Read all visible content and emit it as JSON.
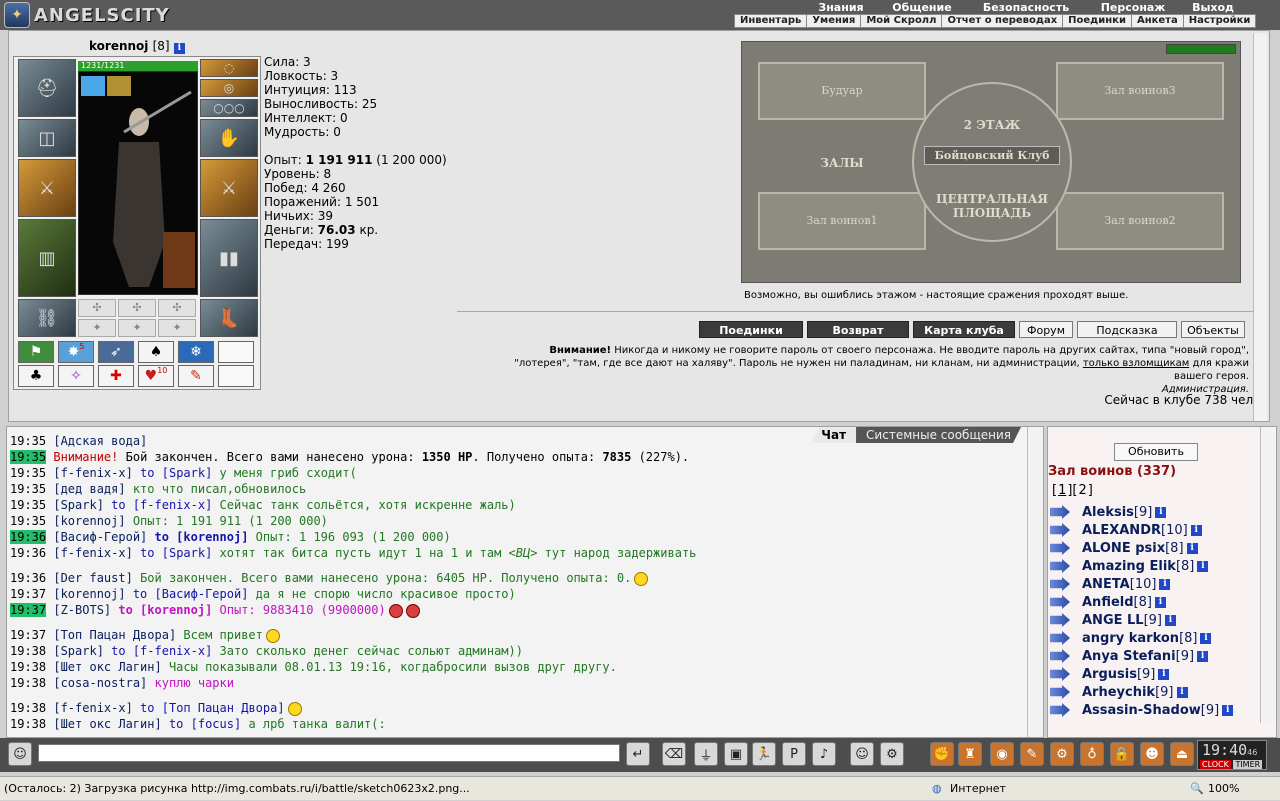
{
  "app": {
    "logo": "ANGELSCITY"
  },
  "menu": {
    "top": [
      "Знания",
      "Общение",
      "Безопасность",
      "Персонаж",
      "Выход"
    ],
    "sub": [
      "Инвентарь",
      "Умения",
      "Мой Скролл",
      "Отчет о переводах",
      "Поединки",
      "Анкета",
      "Настройки"
    ]
  },
  "player": {
    "nick": "korennoj",
    "level": "[8]",
    "hp": "1231/1231",
    "stats": [
      "Сила: 3",
      "Ловкость: 3",
      "Интуиция: 113",
      "Выносливость: 25",
      "Интеллект: 0",
      "Мудрость: 0"
    ],
    "stats2": [
      {
        "label": "Опыт:",
        "bold": "1 191 911",
        "rest": " (1 200 000)"
      },
      {
        "label": "Уровень:",
        "bold": "",
        "rest": " 8"
      },
      {
        "label": "Побед:",
        "bold": "",
        "rest": " 4 260"
      },
      {
        "label": "Поражений:",
        "bold": "",
        "rest": " 1 501"
      },
      {
        "label": "Ничьих:",
        "bold": "",
        "rest": " 39"
      },
      {
        "label": "Деньги:",
        "bold": "76.03",
        "rest": " кр."
      },
      {
        "label": "Передач:",
        "bold": "",
        "rest": " 199"
      }
    ],
    "belt_counts": [
      "5",
      "10"
    ]
  },
  "map": {
    "rooms": [
      "Будуар",
      "Зал воинов3",
      "Зал воинов1",
      "Зал воинов2"
    ],
    "floor": "2 ЭТАЖ",
    "club": "Бойцовский Клуб",
    "halls": "ЗАЛЫ",
    "square": "ЦЕНТРАЛЬНАЯ ПЛОЩАДЬ",
    "note": "Возможно, вы ошиблись этажом - настоящие сражения проходят выше."
  },
  "buttons": [
    "Поединки",
    "Возврат",
    "Карта клуба",
    "Форум",
    "Подсказка",
    "Объекты"
  ],
  "warning": {
    "title": "Внимание!",
    "text1": " Никогда и никому не говорите пароль от своего персонажа. Не вводите пароль на других сайтах, типа \"новый город\",",
    "text2a": "\"лотерея\", \"там, где все дают на халяву\". Пароль не нужен ни паладинам, ни кланам, ни администрации, ",
    "link": "только взломщикам",
    "text2b": " для кражи",
    "text3": "вашего героя.",
    "admin": "Администрация.",
    "online": "Сейчас в клубе 738 чел."
  },
  "chat": {
    "tabs": [
      "Чат",
      "Системные сообщения"
    ],
    "messages": [
      {
        "t": "19:35",
        "hl": false,
        "parts": [
          [
            "n",
            "[Адская вода]"
          ]
        ]
      },
      {
        "t": "19:35",
        "hl": true,
        "parts": [
          [
            "red",
            "Внимание!"
          ],
          [
            "t",
            " Бой закончен. Всего вами нанесено урона: "
          ],
          [
            "tb",
            "1350 HP"
          ],
          [
            "t",
            ". Получено опыта: "
          ],
          [
            "tb",
            "7835"
          ],
          [
            "t",
            " (227%)."
          ]
        ]
      },
      {
        "t": "19:35",
        "hl": false,
        "parts": [
          [
            "n",
            "[f-fenix-x]"
          ],
          [
            "blue",
            " to [Spark]"
          ],
          [
            "g",
            " у меня гриб сходит("
          ]
        ]
      },
      {
        "t": "19:35",
        "hl": false,
        "parts": [
          [
            "n",
            "[дед вадя]"
          ],
          [
            "g",
            " кто что писал,обновилось"
          ]
        ]
      },
      {
        "t": "19:35",
        "hl": false,
        "parts": [
          [
            "n",
            "[Spark]"
          ],
          [
            "blue",
            " to [f-fenix-x]"
          ],
          [
            "g",
            " Сейчас танк сольётся, хотя искренне жаль)"
          ]
        ]
      },
      {
        "t": "19:35",
        "hl": false,
        "parts": [
          [
            "n",
            "[korennoj]"
          ],
          [
            "g",
            " Опыт: 1 191 911 (1 200 000)"
          ]
        ]
      },
      {
        "t": "19:36",
        "hl": true,
        "parts": [
          [
            "n",
            "[Васиф-Герой]"
          ],
          [
            "blueb",
            " to [korennoj]"
          ],
          [
            "g",
            " Опыт: 1 196 093 (1 200 000)"
          ]
        ]
      },
      {
        "t": "19:36",
        "hl": false,
        "parts": [
          [
            "n",
            "[f-fenix-x]"
          ],
          [
            "blue",
            " to [Spark]"
          ],
          [
            "g",
            " хотят так битса пусть идут 1 на 1 и там "
          ],
          [
            "gi",
            "<ВЦ>"
          ],
          [
            "g",
            " тут народ задерживать"
          ]
        ]
      },
      {
        "t": "19:36",
        "hl": false,
        "gap": true,
        "smile": 1,
        "parts": [
          [
            "n",
            "[Der faust]"
          ],
          [
            "g",
            " Бой закончен. Всего вами нанесено урона: 6405 HP. Получено опыта: 0."
          ]
        ]
      },
      {
        "t": "19:37",
        "hl": false,
        "parts": [
          [
            "n",
            "[korennoj]"
          ],
          [
            "blue",
            " to [Васиф-Герой]"
          ],
          [
            "g",
            " да я не спорю число красивое просто)"
          ]
        ]
      },
      {
        "t": "19:37",
        "hl": true,
        "smileR": 2,
        "parts": [
          [
            "n",
            "[Z-BOTS]"
          ],
          [
            "pinkb",
            " to [korennoj]"
          ],
          [
            "pink",
            " Опыт: 9883410 (9900000)"
          ]
        ]
      },
      {
        "t": "19:37",
        "hl": false,
        "gap": true,
        "smile": 1,
        "parts": [
          [
            "n",
            "[Топ Пацан Двора]"
          ],
          [
            "g",
            " Всем привет"
          ]
        ]
      },
      {
        "t": "19:38",
        "hl": false,
        "parts": [
          [
            "n",
            "[Spark]"
          ],
          [
            "blue",
            " to [f-fenix-x]"
          ],
          [
            "g",
            " Зато сколько денег сейчас сольют админам))"
          ]
        ]
      },
      {
        "t": "19:38",
        "hl": false,
        "parts": [
          [
            "n",
            "[Шет окс Лагин]"
          ],
          [
            "g",
            " Часы показывали 08.01.13 19:16, когдабросили вызов друг другу."
          ]
        ]
      },
      {
        "t": "19:38",
        "hl": false,
        "parts": [
          [
            "n",
            "[cosa-nostra]"
          ],
          [
            "pink",
            " куплю чарки"
          ]
        ]
      },
      {
        "t": "19:38",
        "hl": false,
        "gap": true,
        "smile": 1,
        "parts": [
          [
            "n",
            "[f-fenix-x]"
          ],
          [
            "blue",
            " to [Топ Пацан Двора]"
          ]
        ]
      },
      {
        "t": "19:38",
        "hl": false,
        "parts": [
          [
            "n",
            "[Шет окс Лагин]"
          ],
          [
            "blue",
            " to [focus]"
          ],
          [
            "g",
            " а лрб танка валит(:"
          ]
        ]
      }
    ]
  },
  "users": {
    "refresh": "Обновить",
    "room": "Зал воинов (337)",
    "pages": [
      "1",
      "2"
    ],
    "list": [
      {
        "name": "Aleksis",
        "lv": "[9]"
      },
      {
        "name": "ALEXANDR",
        "lv": "[10]"
      },
      {
        "name": "ALONE psix",
        "lv": "[8]"
      },
      {
        "name": "Amazing Elik",
        "lv": "[8]"
      },
      {
        "name": "ANETA",
        "lv": "[10]"
      },
      {
        "name": "Anfield",
        "lv": "[8]"
      },
      {
        "name": "ANGE LL",
        "lv": "[9]"
      },
      {
        "name": "angry karkon",
        "lv": "[8]"
      },
      {
        "name": "Anya Stefani",
        "lv": "[9]"
      },
      {
        "name": "Argusis",
        "lv": "[9]"
      },
      {
        "name": "Arheychik",
        "lv": "[9]"
      },
      {
        "name": "Assasin-Shadow",
        "lv": "[9]"
      }
    ]
  },
  "bottom": {
    "clock": "19:40",
    "sec": "46",
    "clock_label": "CLOCK",
    "timer_label": "TIMER"
  },
  "statusbar": {
    "text": "(Осталось: 2) Загрузка рисунка http://img.combats.ru/i/battle/sketch0623x2.png...",
    "zone": "Интернет",
    "zoom": "100%"
  }
}
